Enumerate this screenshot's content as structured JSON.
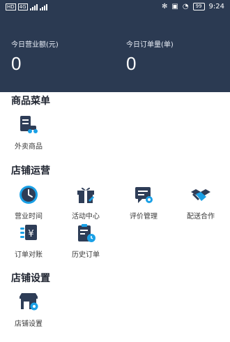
{
  "status_bar": {
    "carrier": "HD",
    "network": "4G",
    "battery": "99",
    "time": "9:24"
  },
  "dashboard": {
    "revenue_label": "今日营业额(元)",
    "revenue_value": "0",
    "orders_label": "今日订单量(单)",
    "orders_value": "0"
  },
  "sections": {
    "products": {
      "title": "商品菜单",
      "items": [
        {
          "label": "外卖商品",
          "icon": "takeout-goods-icon"
        }
      ]
    },
    "operations": {
      "title": "店铺运营",
      "items": [
        {
          "label": "营业时间",
          "icon": "clock-icon"
        },
        {
          "label": "活动中心",
          "icon": "gift-icon"
        },
        {
          "label": "评价管理",
          "icon": "review-icon"
        },
        {
          "label": "配送合作",
          "icon": "handshake-icon"
        },
        {
          "label": "订单对账",
          "icon": "reconcile-icon"
        },
        {
          "label": "历史订单",
          "icon": "order-history-icon"
        }
      ]
    },
    "settings": {
      "title": "店铺设置",
      "items": [
        {
          "label": "店铺设置",
          "icon": "store-settings-icon"
        }
      ]
    }
  },
  "colors": {
    "header_bg": "#2b3a52",
    "icon_dark": "#2e3d57",
    "icon_accent": "#1aa0e6"
  }
}
